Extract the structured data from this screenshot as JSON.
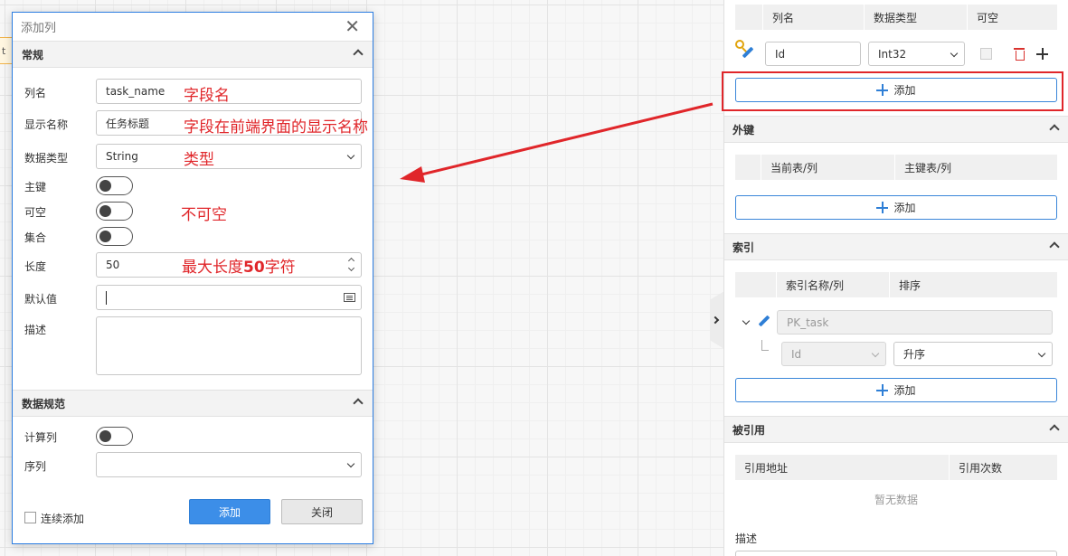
{
  "background": {
    "node_fragment": "t"
  },
  "dialog": {
    "title": "添加列",
    "sections": {
      "general": "常规",
      "data_rules": "数据规范"
    },
    "fields": {
      "name": {
        "label": "列名",
        "value": "task_name"
      },
      "display_name": {
        "label": "显示名称",
        "value": "任务标题"
      },
      "data_type": {
        "label": "数据类型",
        "value": "String"
      },
      "primary_key": {
        "label": "主键"
      },
      "nullable": {
        "label": "可空"
      },
      "collection": {
        "label": "集合"
      },
      "length": {
        "label": "长度",
        "value": "50"
      },
      "default": {
        "label": "默认值",
        "value": ""
      },
      "description": {
        "label": "描述",
        "value": ""
      },
      "computed": {
        "label": "计算列"
      },
      "sequence": {
        "label": "序列",
        "value": ""
      }
    },
    "annotations": {
      "name": "字段名",
      "display_name": "字段在前端界面的显示名称",
      "data_type": "类型",
      "nullable": "不可空",
      "length_prefix": "最大长度",
      "length_num": "50",
      "length_suffix": "字符"
    },
    "footer": {
      "continuous_label": "连续添加",
      "add_label": "添加",
      "close_label": "关闭"
    }
  },
  "panel": {
    "columns_header": {
      "name": "列名",
      "type": "数据类型",
      "nullable": "可空"
    },
    "column_row": {
      "name": "Id",
      "type": "Int32"
    },
    "add_label": "添加",
    "foreign_keys": {
      "title": "外键",
      "col_current": "当前表/列",
      "col_primary": "主键表/列"
    },
    "indexes": {
      "title": "索引",
      "col_name": "索引名称/列",
      "col_order": "排序",
      "index_name": "PK_task",
      "index_column": "Id",
      "index_order": "升序"
    },
    "references": {
      "title": "被引用",
      "col_address": "引用地址",
      "col_count": "引用次数",
      "empty": "暂无数据"
    },
    "description_label": "描述"
  },
  "colors": {
    "accent": "#3c8ee8",
    "annotation": "#e0262a"
  }
}
